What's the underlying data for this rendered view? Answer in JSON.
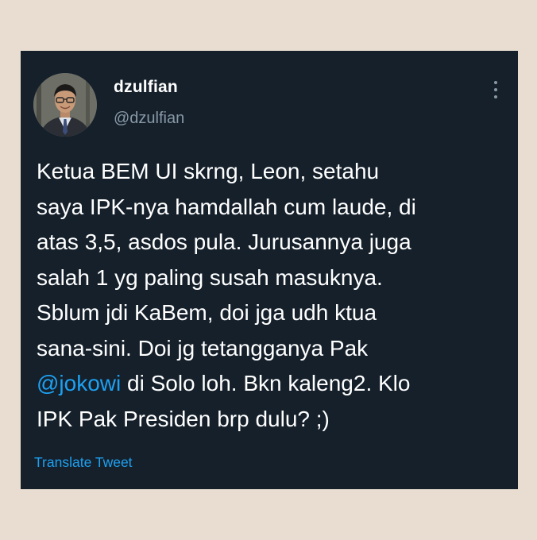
{
  "tweet": {
    "display_name": "dzulfian",
    "handle": "@dzulfian",
    "avatar_icon": "profile-photo",
    "more_icon": "vertical-ellipsis-icon",
    "lines": {
      "l1": "Ketua BEM UI skrng, Leon, setahu",
      "l2": "saya IPK-nya hamdallah cum laude, di",
      "l3": "atas 3,5, asdos pula. Jurusannya juga",
      "l4": "salah 1 yg paling susah masuknya.",
      "l5": "Sblum jdi KaBem, doi jga udh ktua",
      "l6": "sana-sini. Doi jg tetangganya Pak",
      "l7_mention": "@jokowi",
      "l7_rest": " di Solo loh. Bkn kaleng2. Klo",
      "l8": "IPK Pak Presiden brp dulu? ;)"
    },
    "translate_label": "Translate Tweet"
  },
  "colors": {
    "page_background": "#e8ddd0",
    "card_background": "#15202b",
    "text_primary": "#ffffff",
    "text_secondary": "#8899a6",
    "link": "#1da1f2"
  }
}
